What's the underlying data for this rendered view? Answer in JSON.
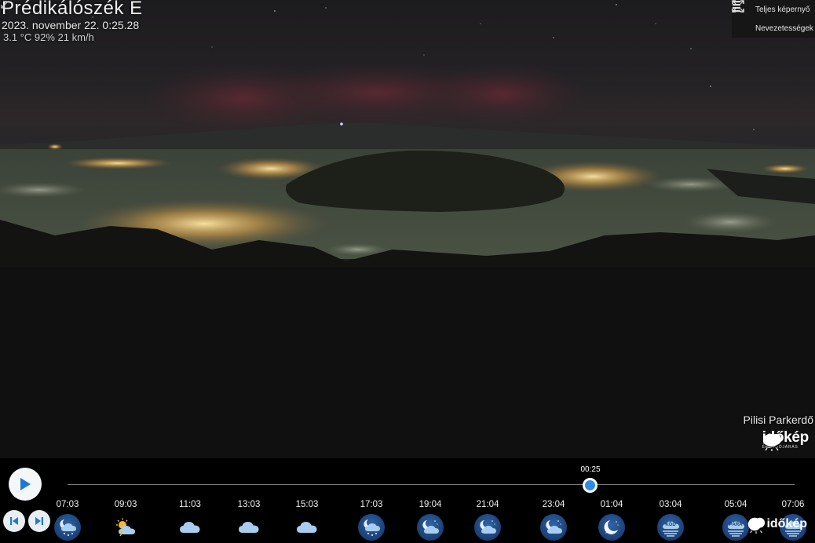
{
  "camera": {
    "title": "Prédikálószék E",
    "datetime": "2023. november 22. 0:25.28",
    "weather_line": "3.1 °C 92% 21 km/h",
    "wind_icon": "wind-direction-arrow-icon",
    "credit": "Pilisi Parkerdő"
  },
  "top_menu": {
    "fullscreen_label": "Teljes képernyő",
    "fullscreen_icon": "expand-icon",
    "landmarks_label": "Nevezetességek",
    "landmarks_icon": "list-icon"
  },
  "brand": {
    "name": "időkép",
    "tagline": "ÉLŐ IDŐJÁRÁS"
  },
  "timeline": {
    "current_time": "00:25",
    "position_fraction": 0.72,
    "play_icon": "play-icon",
    "prev_icon": "skip-back-icon",
    "next_icon": "skip-forward-icon",
    "slots": [
      {
        "time": "07:03",
        "icon": "night-cloud-snow-icon",
        "style": "night"
      },
      {
        "time": "09:03",
        "icon": "sun-cloud-icon",
        "style": "day"
      },
      {
        "time": "11:03",
        "icon": "cloud-icon",
        "style": "day"
      },
      {
        "time": "13:03",
        "icon": "cloud-icon",
        "style": "day"
      },
      {
        "time": "15:03",
        "icon": "cloud-icon",
        "style": "day"
      },
      {
        "time": "17:03",
        "icon": "night-cloud-snow-icon",
        "style": "night"
      },
      {
        "time": "19:04",
        "icon": "night-cloud-icon",
        "style": "night"
      },
      {
        "time": "21:04",
        "icon": "night-cloud-icon",
        "style": "night"
      },
      {
        "time": "23:04",
        "icon": "night-cloud-icon",
        "style": "night"
      },
      {
        "time": "01:04",
        "icon": "moon-icon",
        "style": "night"
      },
      {
        "time": "03:04",
        "icon": "fog-icon",
        "style": "night",
        "badge": "KÖD"
      },
      {
        "time": "05:04",
        "icon": "fog-icon",
        "style": "night",
        "badge": "PÁRA"
      },
      {
        "time": "07:06",
        "icon": "fog-icon",
        "style": "night"
      }
    ]
  },
  "colors": {
    "accent": "#2f8be6",
    "timeline_bg": "#000000",
    "night_icon": "#1b3f72"
  }
}
